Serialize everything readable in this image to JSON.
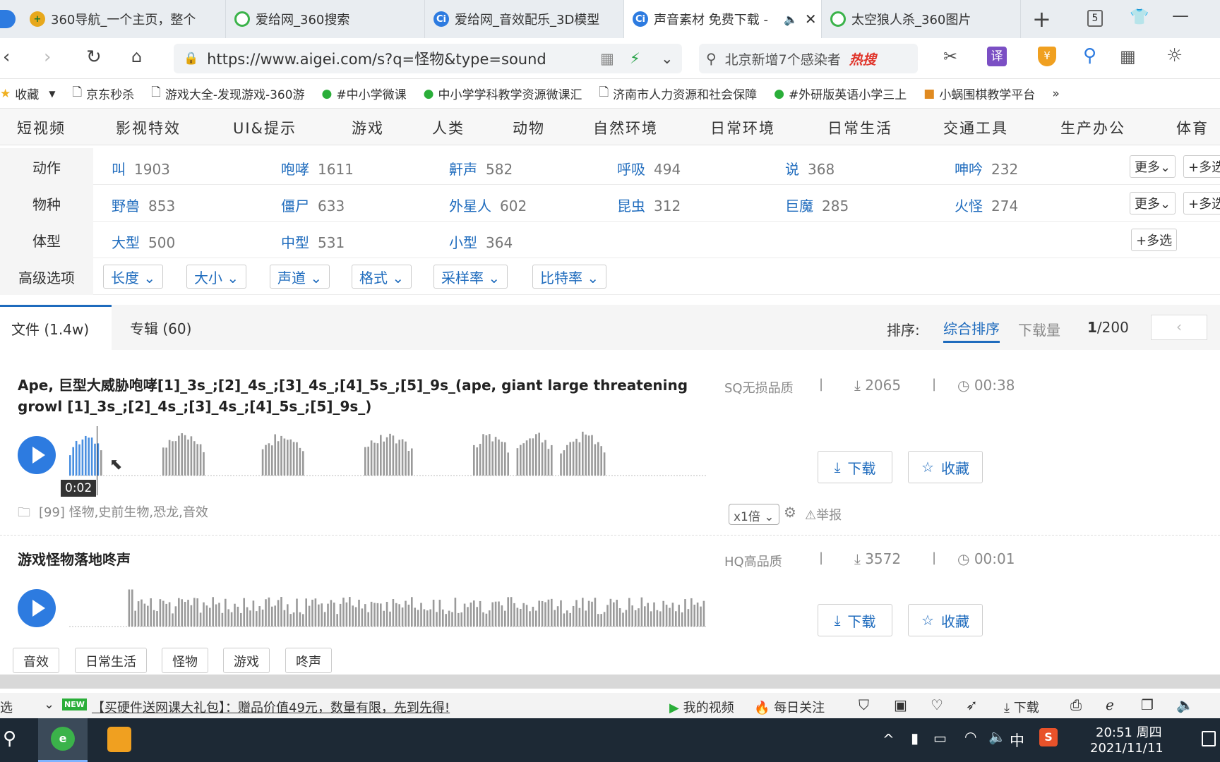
{
  "browser": {
    "tabs": [
      {
        "label": "360导航_一个主页，整个",
        "icon": "360-nav-icon",
        "active": false
      },
      {
        "label": "爱给网_360搜索",
        "icon": "360-search-icon",
        "active": false
      },
      {
        "label": "爱给网_音效配乐_3D模型",
        "icon": "aigei-icon",
        "active": false
      },
      {
        "label": "声音素材 免费下载 -",
        "icon": "aigei-icon",
        "active": true
      },
      {
        "label": "太空狼人杀_360图片",
        "icon": "360-search-icon",
        "active": false
      }
    ],
    "tab_count": "5",
    "url": "https://www.aigei.com/s?q=怪物&type=sound",
    "search_text": "北京新增7个感染者",
    "search_badge": "热搜",
    "translate_label": "译"
  },
  "bookmarks": [
    {
      "label": "收藏",
      "icon": "star-icon"
    },
    {
      "label": "京东秒杀",
      "icon": "page-icon"
    },
    {
      "label": "游戏大全-发现游戏-360游",
      "icon": "page-icon"
    },
    {
      "label": "#中小学微课",
      "icon": "wechat-icon"
    },
    {
      "label": "中小学学科教学资源微课汇",
      "icon": "wechat-icon"
    },
    {
      "label": "济南市人力资源和社会保障",
      "icon": "page-icon"
    },
    {
      "label": "#外研版英语小学三上",
      "icon": "wechat-icon"
    },
    {
      "label": "小蜗围棋教学平台",
      "icon": "app-icon"
    }
  ],
  "bookmarks_more": "»",
  "categories": [
    "短视频",
    "影视特效",
    "UI&提示",
    "游戏",
    "人类",
    "动物",
    "自然环境",
    "日常环境",
    "日常生活",
    "交通工具",
    "生产办公",
    "体育"
  ],
  "filters": [
    {
      "label": "动作",
      "items": [
        {
          "name": "叫",
          "count": "1903"
        },
        {
          "name": "咆哮",
          "count": "1611"
        },
        {
          "name": "鼾声",
          "count": "582"
        },
        {
          "name": "呼吸",
          "count": "494"
        },
        {
          "name": "说",
          "count": "368"
        },
        {
          "name": "呻吟",
          "count": "232"
        }
      ],
      "more": "更多",
      "multi": "多选"
    },
    {
      "label": "物种",
      "items": [
        {
          "name": "野兽",
          "count": "853"
        },
        {
          "name": "僵尸",
          "count": "633"
        },
        {
          "name": "外星人",
          "count": "602"
        },
        {
          "name": "昆虫",
          "count": "312"
        },
        {
          "name": "巨魔",
          "count": "285"
        },
        {
          "name": "火怪",
          "count": "274"
        }
      ],
      "more": "更多",
      "multi": "多选"
    },
    {
      "label": "体型",
      "items": [
        {
          "name": "大型",
          "count": "500"
        },
        {
          "name": "中型",
          "count": "531"
        },
        {
          "name": "小型",
          "count": "364"
        }
      ],
      "multi": "多选"
    }
  ],
  "advanced": {
    "label": "高级选项",
    "options": [
      "长度",
      "大小",
      "声道",
      "格式",
      "采样率",
      "比特率"
    ]
  },
  "results": {
    "tabs": [
      {
        "label": "文件 (1.4w)",
        "active": true
      },
      {
        "label": "专辑 (60)",
        "active": false
      }
    ],
    "sort_label": "排序:",
    "sort_options": [
      "综合排序",
      "下载量"
    ],
    "page_current": "1",
    "page_total": "/200",
    "items": [
      {
        "title": "Ape, 巨型大威胁咆哮[1]_3s_;[2]_4s_;[3]_4s_;[4]_5s_;[5]_9s_(ape, giant large threatening growl [1]_3s_;[2]_4s_;[3]_4s_;[4]_5s_;[5]_9s_)",
        "quality": "SQ无损品质",
        "downloads": "2065",
        "duration": "00:38",
        "time_tooltip": "0:02",
        "tags_line": "[99] 怪物,史前生物,恐龙,音效",
        "speed": "x1倍",
        "report": "举报",
        "progress": 0.046
      },
      {
        "title": "游戏怪物落地咚声",
        "quality": "HQ高品质",
        "downloads": "3572",
        "duration": "00:01",
        "tags": [
          "音效",
          "日常生活",
          "怪物",
          "游戏",
          "咚声"
        ]
      }
    ],
    "download_label": "下载",
    "favorite_label": "收藏"
  },
  "statusbar": {
    "left": "选",
    "badge": "NEW",
    "promo": "【买硬件送网课大礼包】：赠品价值49元，数量有限，先到先得!",
    "my_video": "我的视频",
    "daily": "每日关注",
    "download": "下载"
  },
  "taskbar": {
    "ime": "中",
    "time": "20:51 周四",
    "date": "2021/11/11"
  },
  "colors": {
    "accent": "#1e6bbd",
    "play": "#2d7be0",
    "wave": "#9a9a9a",
    "wave_played": "#4a8fe0",
    "hot": "#e0342a"
  }
}
